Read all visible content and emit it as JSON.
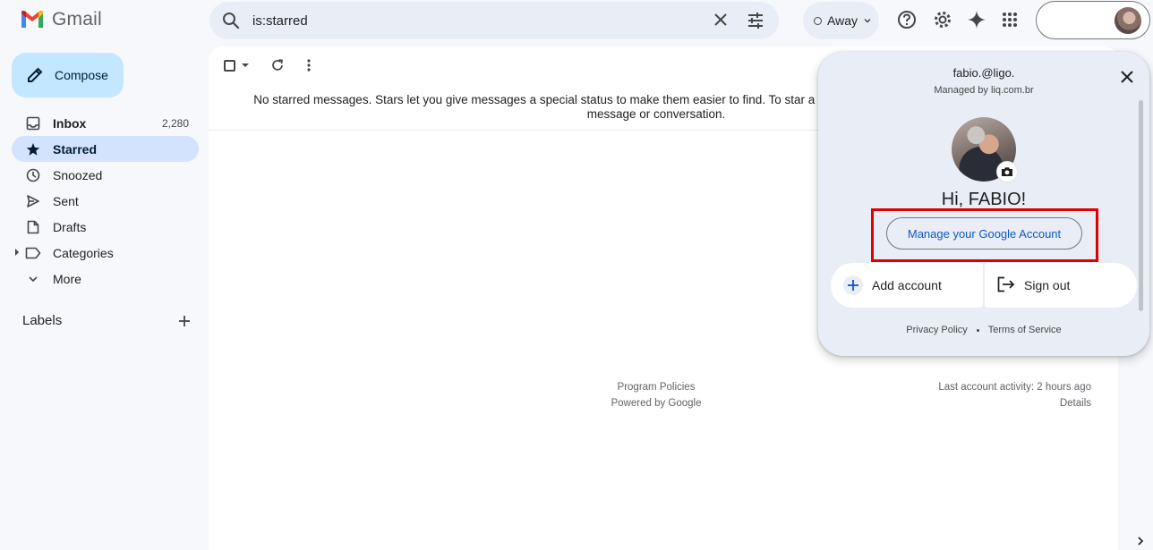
{
  "header": {
    "logo_text": "Gmail",
    "search_value": "is:starred",
    "status_label": "Away"
  },
  "sidebar": {
    "compose_label": "Compose",
    "items": [
      {
        "label": "Inbox",
        "count": "2,280"
      },
      {
        "label": "Starred"
      },
      {
        "label": "Snoozed"
      },
      {
        "label": "Sent"
      },
      {
        "label": "Drafts"
      },
      {
        "label": "Categories"
      },
      {
        "label": "More"
      }
    ],
    "labels_heading": "Labels"
  },
  "main": {
    "empty_message": "No starred messages. Stars let you give messages a special status to make them easier to find. To star a message, click on the star outline beside any message or conversation.",
    "footer_links": [
      "Program Policies",
      "Powered by Google"
    ],
    "activity_text": "Last account activity: 2 hours ago",
    "details_link": "Details"
  },
  "account_popup": {
    "email": "fabio.@ligo.",
    "managed_by": "Managed by liq.com.br",
    "greeting": "Hi, FABIO!",
    "manage_button": "Manage your Google Account",
    "add_account": "Add account",
    "sign_out": "Sign out",
    "privacy": "Privacy Policy",
    "terms": "Terms of Service"
  },
  "colors": {
    "accent": "#0b57d0",
    "compose_bg": "#c2e7ff",
    "active_nav": "#d3e3fd",
    "highlight": "#e00000"
  }
}
